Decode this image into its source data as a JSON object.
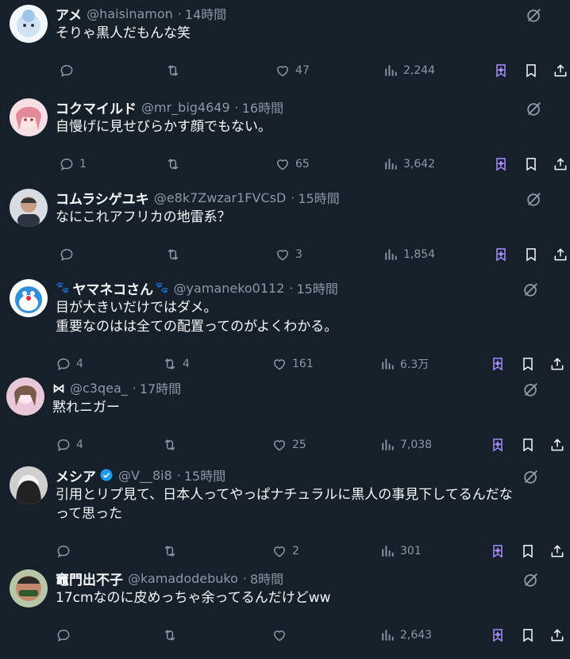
{
  "tweets": [
    {
      "name": "アメ",
      "handle": "@haisinamon",
      "time": "14時間",
      "lines": [
        "そりゃ黒人だもんな笑"
      ],
      "replies": "",
      "retweets": "",
      "likes": "47",
      "views": "2,244",
      "avatar_color": "#cfe3f2"
    },
    {
      "name": "コクマイルド",
      "handle": "@mr_big4649",
      "time": "16時間",
      "lines": [
        "自慢げに見せびらかす顔でもない。"
      ],
      "replies": "1",
      "retweets": "",
      "likes": "65",
      "views": "3,642",
      "avatar_color": "#e58a9a"
    },
    {
      "name": "コムラシゲユキ",
      "handle": "@e8k7Zwzar1FVCsD",
      "time": "15時間",
      "lines": [
        "なにこれアフリカの地雷系？"
      ],
      "replies": "",
      "retweets": "",
      "likes": "3",
      "views": "1,854",
      "avatar_color": "#7a8a9a"
    },
    {
      "name": "ヤマネコさん",
      "handle": "@yamaneko0112",
      "time": "15時間",
      "lines": [
        "目が大きいだけではダメ。",
        "重要なのはは全ての配置ってのがよくわかる。"
      ],
      "replies": "4",
      "retweets": "4",
      "likes": "161",
      "views": "6.3万",
      "avatar_color": "#2f8fd8"
    },
    {
      "name": "",
      "handle": "@c3qea_",
      "time": "17時間",
      "lines": [
        "黙れニガー"
      ],
      "replies": "4",
      "retweets": "",
      "likes": "25",
      "views": "7,038",
      "avatar_color": "#e9c8d8"
    },
    {
      "name": "メシア",
      "handle": "@V__8i8",
      "time": "15時間",
      "lines": [
        "引用とリプ見て、日本人ってやっぱナチュラルに黒人の事見下してるんだな",
        "って思った"
      ],
      "replies": "",
      "retweets": "",
      "likes": "2",
      "views": "301",
      "avatar_color": "#cfcfcf"
    },
    {
      "name": "竈門出不子",
      "handle": "@kamadodebuko",
      "time": "8時間",
      "lines": [
        "17cmなのに皮めっちゃ余ってるんだけどww"
      ],
      "replies": "",
      "retweets": "",
      "likes": "",
      "views": "2,643",
      "avatar_color": "#c28a6a"
    }
  ],
  "colors": {
    "background": "#15202b",
    "text": "#f7f9f9",
    "muted": "#8b98a5",
    "accent": "#a98cff",
    "verified": "#1d9bf0"
  },
  "icons": {
    "reply": "reply-icon",
    "retweet": "retweet-icon",
    "like": "heart-icon",
    "views": "views-icon",
    "grok": "grok-icon",
    "bookmark": "bookmark-icon",
    "share": "share-icon",
    "premium_bookmark": "premium-bookmark-icon"
  }
}
